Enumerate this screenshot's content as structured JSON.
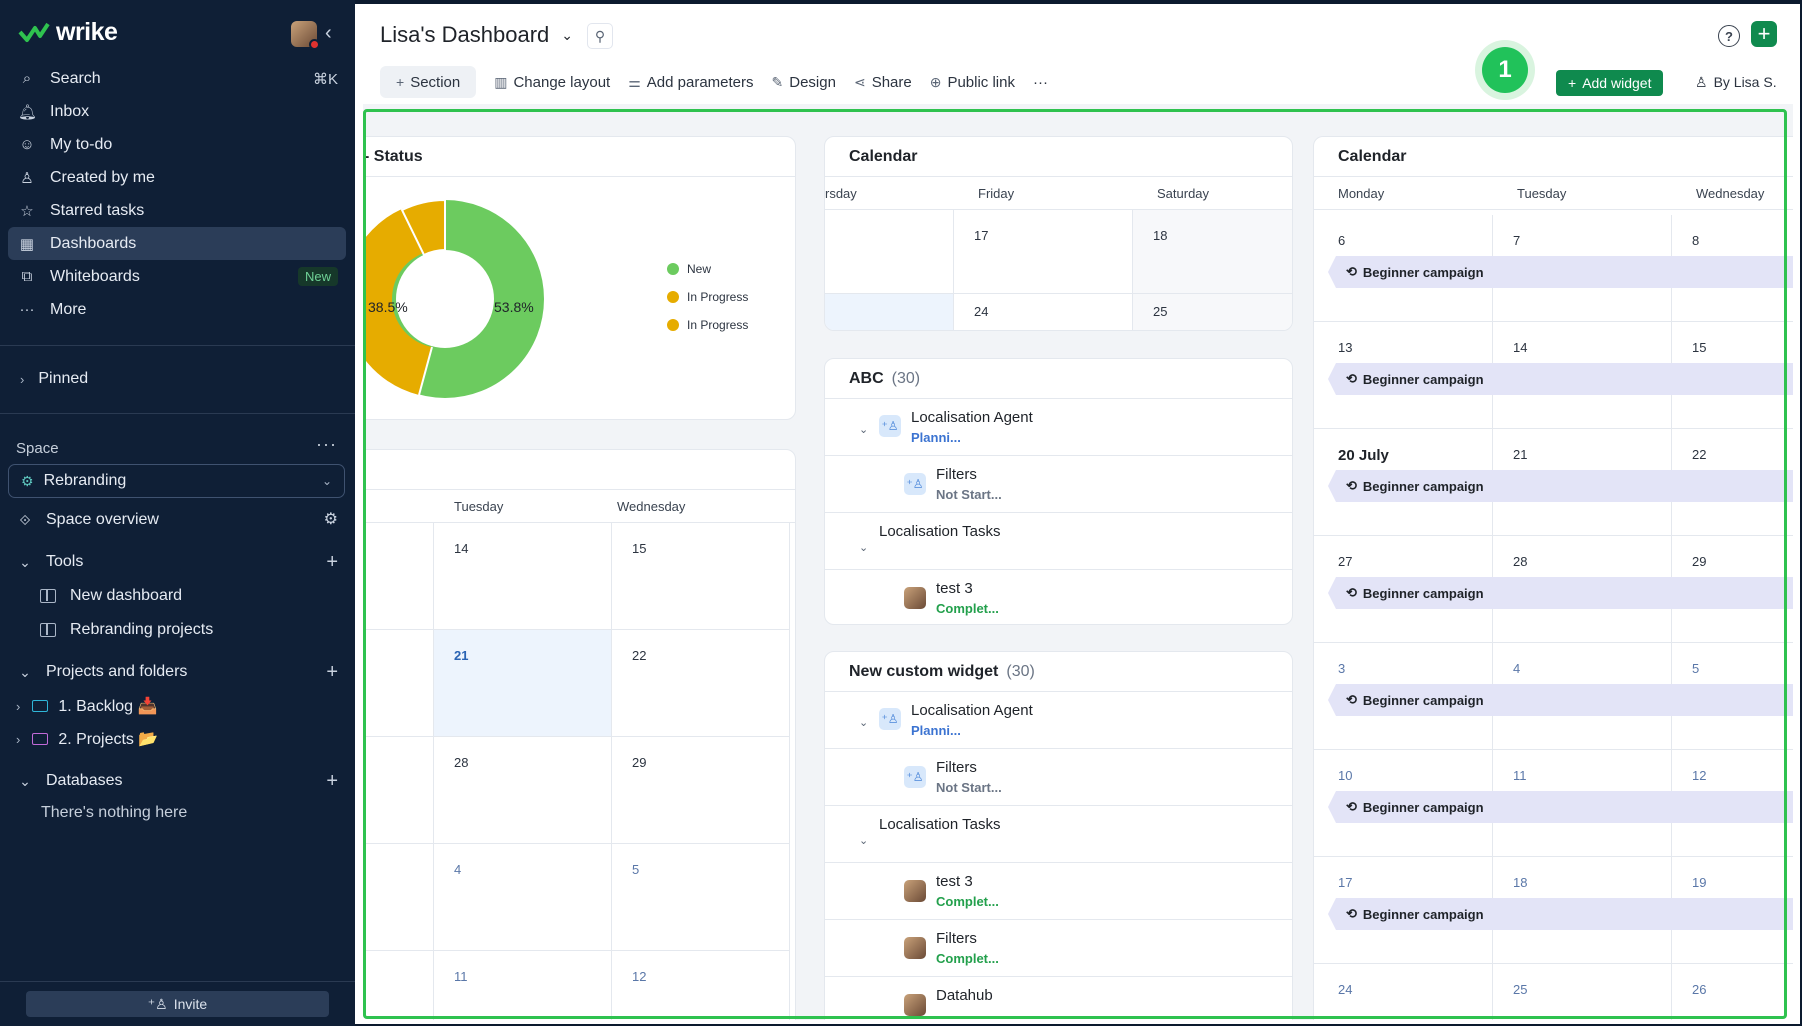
{
  "sidebar": {
    "logo": "wrike",
    "nav": [
      {
        "label": "Search",
        "icon": "search-icon",
        "shortcut": "⌘K"
      },
      {
        "label": "Inbox",
        "icon": "bell-icon"
      },
      {
        "label": "My to-do",
        "icon": "user-check-icon"
      },
      {
        "label": "Created by me",
        "icon": "user-icon"
      },
      {
        "label": "Starred tasks",
        "icon": "star-icon"
      },
      {
        "label": "Dashboards",
        "icon": "dashboard-icon",
        "active": true
      },
      {
        "label": "Whiteboards",
        "icon": "whiteboard-icon",
        "badge": "New"
      },
      {
        "label": "More",
        "icon": "more-icon"
      }
    ],
    "pinned": "Pinned",
    "space_label": "Space",
    "space_name": "Rebranding",
    "space_overview": "Space overview",
    "tools": "Tools",
    "tools_items": [
      "New dashboard",
      "Rebranding projects"
    ],
    "projects": "Projects and folders",
    "project_items": [
      {
        "label": "1. Backlog 📥",
        "color": "#2fb6d9"
      },
      {
        "label": "2. Projects 📂",
        "color": "#c26ad8"
      }
    ],
    "databases": "Databases",
    "nothing": "There's nothing here",
    "invite": "Invite"
  },
  "header": {
    "title": "Lisa's Dashboard",
    "toolbar": {
      "section": "Section",
      "change_layout": "Change layout",
      "add_parameters": "Add parameters",
      "design": "Design",
      "share": "Share",
      "public_link": "Public link",
      "more": "···"
    },
    "add_widget": "Add widget",
    "by": "By Lisa S.",
    "step_badge": "1"
  },
  "status_widget": {
    "title": "- Status",
    "left_pct": "38.5%",
    "right_pct": "53.8%",
    "legend": [
      {
        "label": "New",
        "color": "#6ccb5f"
      },
      {
        "label": "In Progress",
        "color": "#e6ac00"
      },
      {
        "label": "In Progress",
        "color": "#e6ac00"
      }
    ]
  },
  "left_calendar": {
    "headers": [
      "Tuesday",
      "Wednesday"
    ],
    "rows": [
      [
        "14",
        "15"
      ],
      [
        "21",
        "22"
      ],
      [
        "28",
        "29"
      ],
      [
        "4",
        "5"
      ],
      [
        "11",
        "12"
      ]
    ]
  },
  "mid_calendar": {
    "title": "Calendar",
    "headers": [
      "rsday",
      "Friday",
      "Saturday"
    ],
    "row1": [
      "17",
      "18"
    ],
    "row2": [
      "24",
      "25"
    ]
  },
  "abc_widget": {
    "title": "ABC",
    "count": "(30)",
    "items": [
      {
        "name": "Localisation Agent",
        "status": "Planni...",
        "kind": "plan"
      },
      {
        "name": "Filters",
        "status": "Not Start...",
        "kind": "not"
      },
      {
        "name": "Localisation Tasks",
        "status": "",
        "kind": ""
      },
      {
        "name": "test 3",
        "status": "Complet...",
        "kind": "comp"
      }
    ]
  },
  "custom_widget": {
    "title": "New custom widget",
    "count": "(30)",
    "items": [
      {
        "name": "Localisation Agent",
        "status": "Planni..."
      },
      {
        "name": "Filters",
        "status": "Not Start..."
      },
      {
        "name": "Localisation Tasks",
        "status": ""
      },
      {
        "name": "test 3",
        "status": "Complet..."
      },
      {
        "name": "Filters",
        "status": "Complet..."
      },
      {
        "name": "Datahub",
        "status": ""
      }
    ]
  },
  "right_calendar": {
    "title": "Calendar",
    "headers": [
      "Monday",
      "Tuesday",
      "Wednesday"
    ],
    "weeks": [
      {
        "days": [
          "6",
          "7",
          "8"
        ],
        "first_bold": false
      },
      {
        "days": [
          "13",
          "14",
          "15"
        ],
        "first_bold": false
      },
      {
        "days": [
          "20 July",
          "21",
          "22"
        ],
        "first_bold": true
      },
      {
        "days": [
          "27",
          "28",
          "29"
        ],
        "first_bold": false
      },
      {
        "days": [
          "3",
          "4",
          "5"
        ],
        "first_bold": false,
        "dim": true
      },
      {
        "days": [
          "10",
          "11",
          "12"
        ],
        "first_bold": false,
        "dim": true
      },
      {
        "days": [
          "17",
          "18",
          "19"
        ],
        "first_bold": false,
        "dim": true
      },
      {
        "days": [
          "24",
          "25",
          "26"
        ],
        "first_bold": false,
        "dim": true
      }
    ],
    "event": "Beginner campaign"
  }
}
